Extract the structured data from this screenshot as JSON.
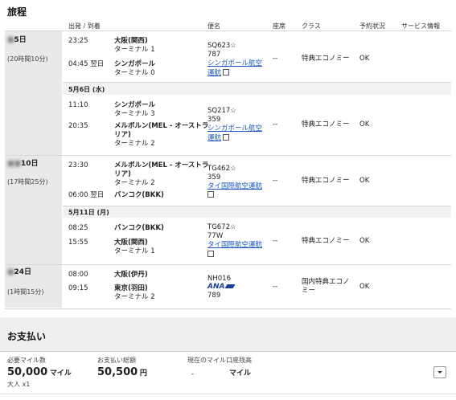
{
  "itinerary": {
    "title": "旅程",
    "headers": {
      "dep_arr": "出発 / 到着",
      "flight": "便名",
      "seat": "座席",
      "class": "クラス",
      "status": "予約状況",
      "service": "サービス情報"
    },
    "days": [
      {
        "date": "5日",
        "duration": "(20時間10分)"
      },
      {
        "date": "10日",
        "duration": "(17時間25分)"
      },
      {
        "date": "24日",
        "duration": "(1時間15分)"
      }
    ],
    "subheaders": [
      "5月6日 (水)",
      "5月11日 (月)"
    ],
    "legs": [
      {
        "dep_time": "23:25",
        "dep_airport": "大阪(関西)",
        "dep_terminal": "ターミナル 1",
        "arr_time": "04:45 翌日",
        "arr_airport": "シンガポール",
        "arr_terminal": "ターミナル 0",
        "flight_no": "SQ623☆",
        "aircraft": "787",
        "airline_1": "シンガポール航空",
        "airline_2": "運航",
        "seat": "--",
        "class": "特典エコノミー",
        "status": "OK"
      },
      {
        "dep_time": "11:10",
        "dep_airport": "シンガポール",
        "dep_terminal": "ターミナル 3",
        "arr_time": "20:35",
        "arr_airport_1": "メルボルン(MEL - オーストラ",
        "arr_airport_2": "リア)",
        "arr_terminal": "ターミナル 2",
        "flight_no": "SQ217☆",
        "aircraft": "359",
        "airline_1": "シンガポール航空",
        "airline_2": "運航",
        "seat": "--",
        "class": "特典エコノミー",
        "status": "OK"
      },
      {
        "dep_time": "23:30",
        "dep_airport_1": "メルボルン(MEL - オーストラ",
        "dep_airport_2": "リア)",
        "dep_terminal": "ターミナル 2",
        "arr_time": "06:00 翌日",
        "arr_airport": "バンコク(BKK)",
        "flight_no": "TG462☆",
        "aircraft": "359",
        "airline_1": "タイ国際航空運航",
        "seat": "--",
        "class": "特典エコノミー",
        "status": "OK"
      },
      {
        "dep_time": "08:25",
        "dep_airport": "バンコク(BKK)",
        "arr_time": "15:55",
        "arr_airport": "大阪(関西)",
        "arr_terminal": "ターミナル 1",
        "flight_no": "TG672☆",
        "aircraft": "77W",
        "airline_1": "タイ国際航空運航",
        "seat": "--",
        "class": "特典エコノミー",
        "status": "OK"
      },
      {
        "dep_time": "08:00",
        "dep_airport": "大阪(伊丹)",
        "arr_time": "09:15",
        "arr_airport": "東京(羽田)",
        "arr_terminal": "ターミナル 2",
        "flight_no": "NH016",
        "airline_logo": "ANA",
        "aircraft": "789",
        "seat": "--",
        "class_1": "国内特典エコノ",
        "class_2": "ミー",
        "status": "OK"
      }
    ]
  },
  "payment": {
    "title": "お支払い",
    "miles_label": "必要マイル数",
    "miles_value": "50,000",
    "miles_unit": "マイル",
    "pax": "大人 x1",
    "total_label": "お支払い総額",
    "total_value": "50,500",
    "total_unit": "円",
    "balance_label": "現在のマイル口座残高",
    "balance_value": "-",
    "balance_unit": "マイル",
    "dropdown_icon": "chevron-down-icon"
  },
  "colors": {
    "link": "#1a56b8",
    "ana_blue": "#1b3f94"
  }
}
